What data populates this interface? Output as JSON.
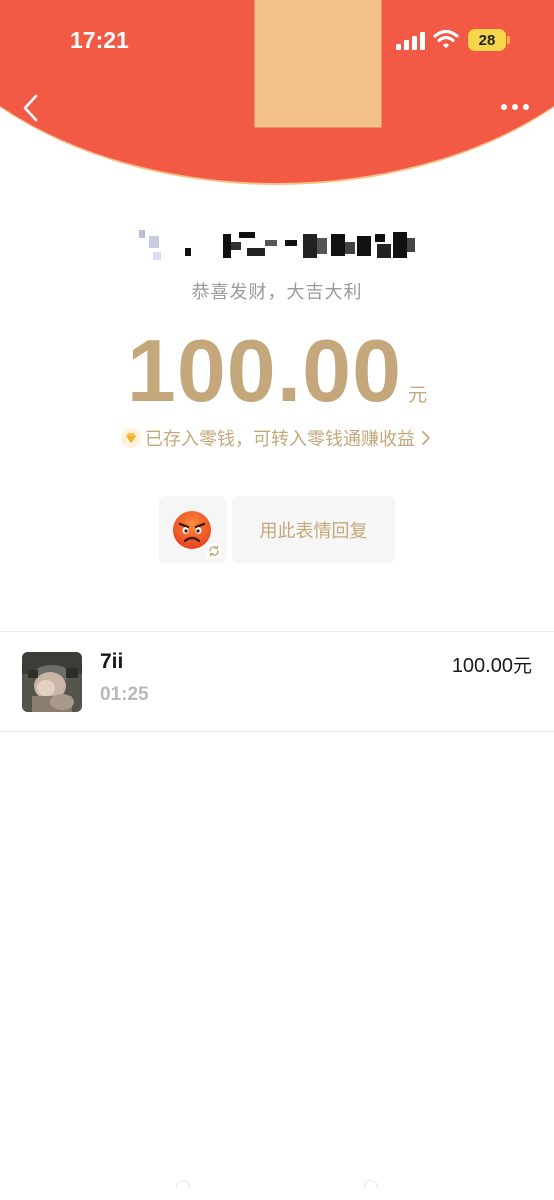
{
  "status_bar": {
    "time": "17:21",
    "battery": "28",
    "signal_icon": "cellular-signal-icon",
    "wifi_icon": "wifi-icon"
  },
  "nav": {
    "back_icon": "chevron-left-icon",
    "more_icon": "more-dots-icon"
  },
  "red_packet": {
    "greeting": "恭喜发财，大吉大利",
    "amount": "100.00",
    "amount_unit": "元",
    "wallet_notice": "已存入零钱，可转入零钱通赚收益",
    "reply_label": "用此表情回复",
    "emoji_icon": "angry-face-emoji-icon"
  },
  "receivers": [
    {
      "name": "7ii",
      "time": "01:25",
      "amount": "100.00",
      "unit": "元"
    }
  ],
  "colors": {
    "header_red": "#f35a45",
    "gold": "#c4a77b",
    "battery_yellow": "#f8d64a"
  }
}
